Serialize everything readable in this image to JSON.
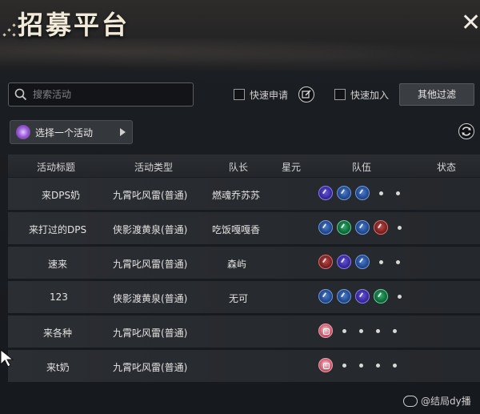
{
  "window": {
    "title": "招募平台"
  },
  "toolbar": {
    "search_placeholder": "搜索活动",
    "quick_apply_label": "快速申请",
    "quick_join_label": "快速加入",
    "other_filters_label": "其他过滤"
  },
  "activity_select": {
    "label": "选择一个活动"
  },
  "table": {
    "headers": [
      "活动标题",
      "活动类型",
      "队长",
      "星元",
      "队伍",
      "状态"
    ],
    "rows": [
      {
        "title": "来DPS奶",
        "type": "九霄叱风雷(普通)",
        "leader": "燃魂乔苏苏",
        "stars": "",
        "status": "",
        "team": [
          "purple",
          "blue",
          "blue",
          "empty",
          "empty"
        ]
      },
      {
        "title": "来打过的DPS",
        "type": "侠影渡黄泉(普通)",
        "leader": "吃饭嘎嘎香",
        "stars": "",
        "status": "",
        "team": [
          "blue",
          "green",
          "blue",
          "red",
          "empty"
        ]
      },
      {
        "title": "速来",
        "type": "九霄叱风雷(普通)",
        "leader": "森屿",
        "stars": "",
        "status": "",
        "team": [
          "red",
          "purple",
          "blue",
          "empty",
          "empty"
        ]
      },
      {
        "title": "123",
        "type": "侠影渡黄泉(普通)",
        "leader": "无可",
        "stars": "",
        "status": "",
        "team": [
          "blue",
          "blue",
          "purple",
          "green",
          "empty"
        ]
      },
      {
        "title": "来各种",
        "type": "九霄叱风雷(普通)",
        "leader": "",
        "stars": "",
        "status": "",
        "team": [
          "pink",
          "empty",
          "empty",
          "empty",
          "empty"
        ]
      },
      {
        "title": "来t奶",
        "type": "九霄叱风雷(普通)",
        "leader": "",
        "stars": "",
        "status": "",
        "team": [
          "pink",
          "empty",
          "empty",
          "empty",
          "empty"
        ]
      }
    ]
  },
  "watermark": {
    "text": "@结局dy播"
  }
}
